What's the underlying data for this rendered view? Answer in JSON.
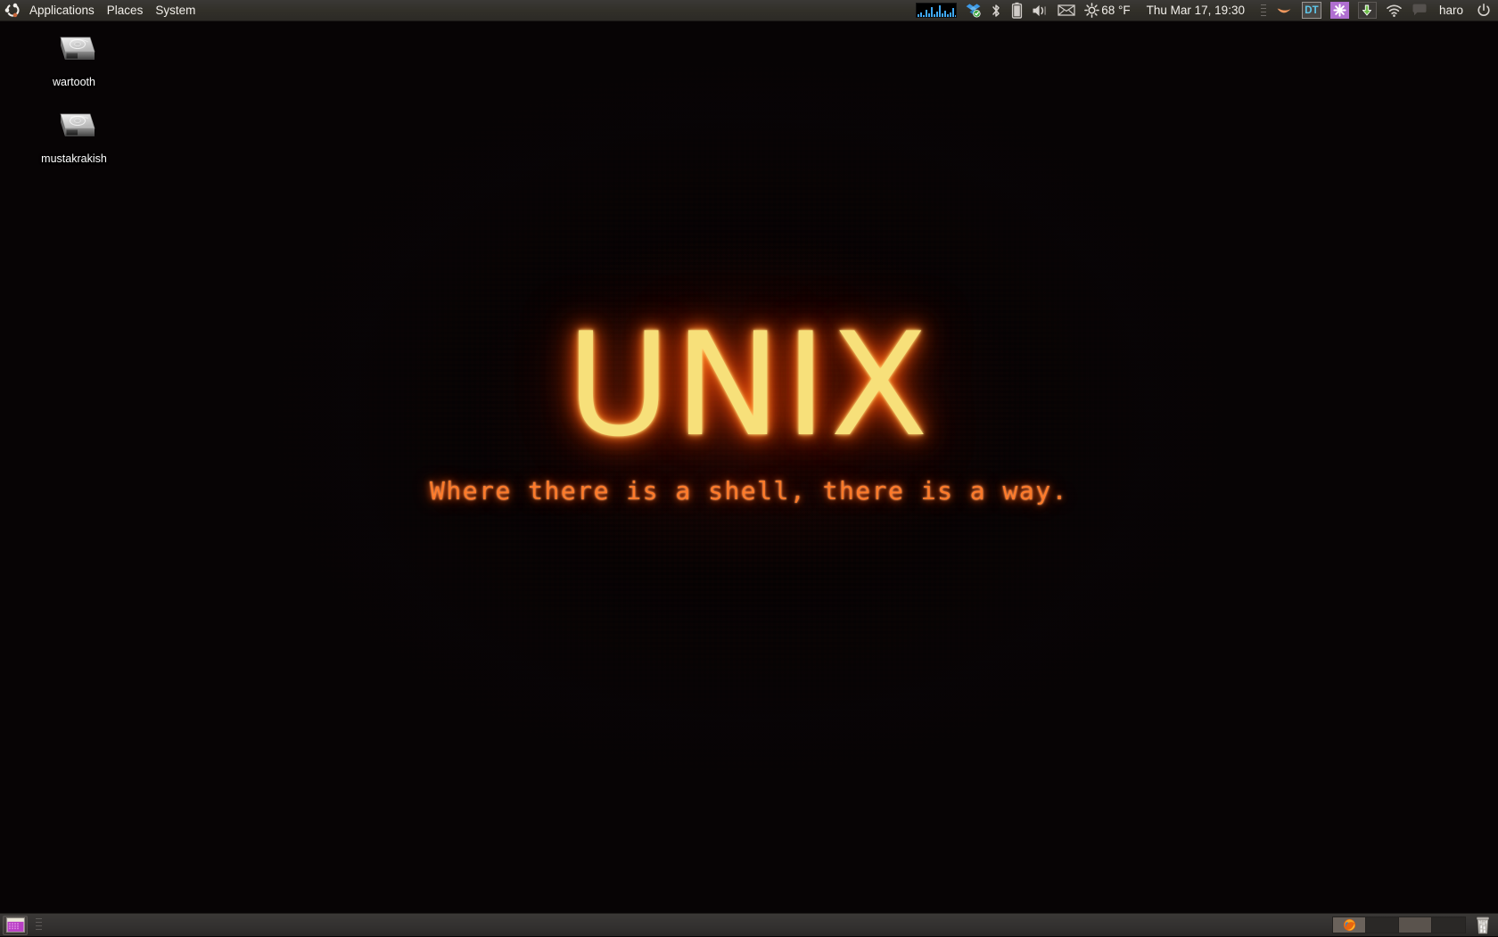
{
  "desktop": {
    "wallpaper": {
      "title": "UNIX",
      "tagline": "Where there is a shell, there is a way.",
      "title_color": "#f7e07a",
      "glow_color": "#ff5c10",
      "tagline_color": "#ff7a2a",
      "background_color": "#0b0506",
      "texture_color": "#761616"
    },
    "icons": [
      {
        "label": "wartooth",
        "icon": "hard-drive-icon"
      },
      {
        "label": "mustakrakish",
        "icon": "hard-drive-icon"
      }
    ]
  },
  "top_panel": {
    "background_color": "#323029",
    "logo": "ubuntu-logo",
    "menus": [
      {
        "label": "Applications"
      },
      {
        "label": "Places"
      },
      {
        "label": "System"
      }
    ],
    "tray": [
      {
        "name": "system-monitor-applet",
        "icon": "system-monitor-graph-icon"
      },
      {
        "name": "dropbox-indicator",
        "icon": "dropbox-icon"
      },
      {
        "name": "bluetooth-indicator",
        "icon": "bluetooth-icon"
      },
      {
        "name": "battery-indicator",
        "icon": "battery-icon"
      },
      {
        "name": "volume-indicator",
        "icon": "speaker-icon"
      },
      {
        "name": "mail-indicator",
        "icon": "envelope-icon"
      },
      {
        "name": "weather-indicator",
        "icon": "sun-icon"
      }
    ],
    "weather": "68 °F",
    "clock": "Thu Mar 17, 19:30",
    "notification_area": [
      {
        "name": "redshift-indicator",
        "icon": "crescent-icon"
      },
      {
        "name": "devilspie-indicator",
        "icon": "dt-icon",
        "label": "DT"
      },
      {
        "name": "snowflake-indicator",
        "icon": "asterisk-icon"
      },
      {
        "name": "update-manager-indicator",
        "icon": "download-arrow-icon"
      },
      {
        "name": "wifi-indicator",
        "icon": "wifi-icon"
      },
      {
        "name": "chat-indicator",
        "icon": "speech-bubble-icon"
      }
    ],
    "username": "haro",
    "power": "power-icon"
  },
  "bottom_panel": {
    "background_color": "#333130",
    "show_desktop": "show-desktop-button",
    "window_list": [],
    "workspaces": [
      {
        "index": 1,
        "state": "active",
        "has_window": true,
        "window_icon": "firefox-icon"
      },
      {
        "index": 2,
        "state": "empty",
        "has_window": false
      },
      {
        "index": 3,
        "state": "lit",
        "has_window": false
      },
      {
        "index": 4,
        "state": "empty",
        "has_window": false
      }
    ],
    "trash": "trash-icon"
  }
}
